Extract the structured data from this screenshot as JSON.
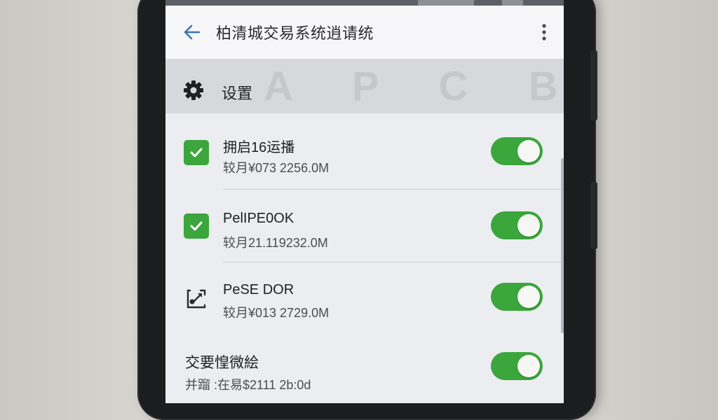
{
  "appbar": {
    "title": "柏清城交易系统逍请统",
    "back_icon": "arrow-left-icon",
    "more_icon": "more-vertical-icon"
  },
  "section": {
    "label": "设置",
    "icon": "gear-icon",
    "watermark": "A P C B"
  },
  "items": [
    {
      "title": "拥启16运播",
      "subtitle": "较月¥073 2256.0M",
      "icon": "check-icon",
      "enabled": true
    },
    {
      "title": "PelIPE0OK",
      "subtitle": "较月21.119232.0M",
      "icon": "check-icon",
      "enabled": true
    },
    {
      "title": "PeSE DOR",
      "subtitle": "较月¥013 2729.0M",
      "icon": "sync-icon",
      "enabled": true
    },
    {
      "title": "交要惶微絵",
      "subtitle": "并蹓 :在易$2111 2b:0d",
      "icon": "",
      "enabled": true
    }
  ],
  "colors": {
    "accent": "#3aa63b",
    "appbar_bg": "#f6f6f8",
    "section_bg": "#d7d8dc",
    "screen_bg": "#ecedf1",
    "back_arrow": "#3f74b6"
  }
}
